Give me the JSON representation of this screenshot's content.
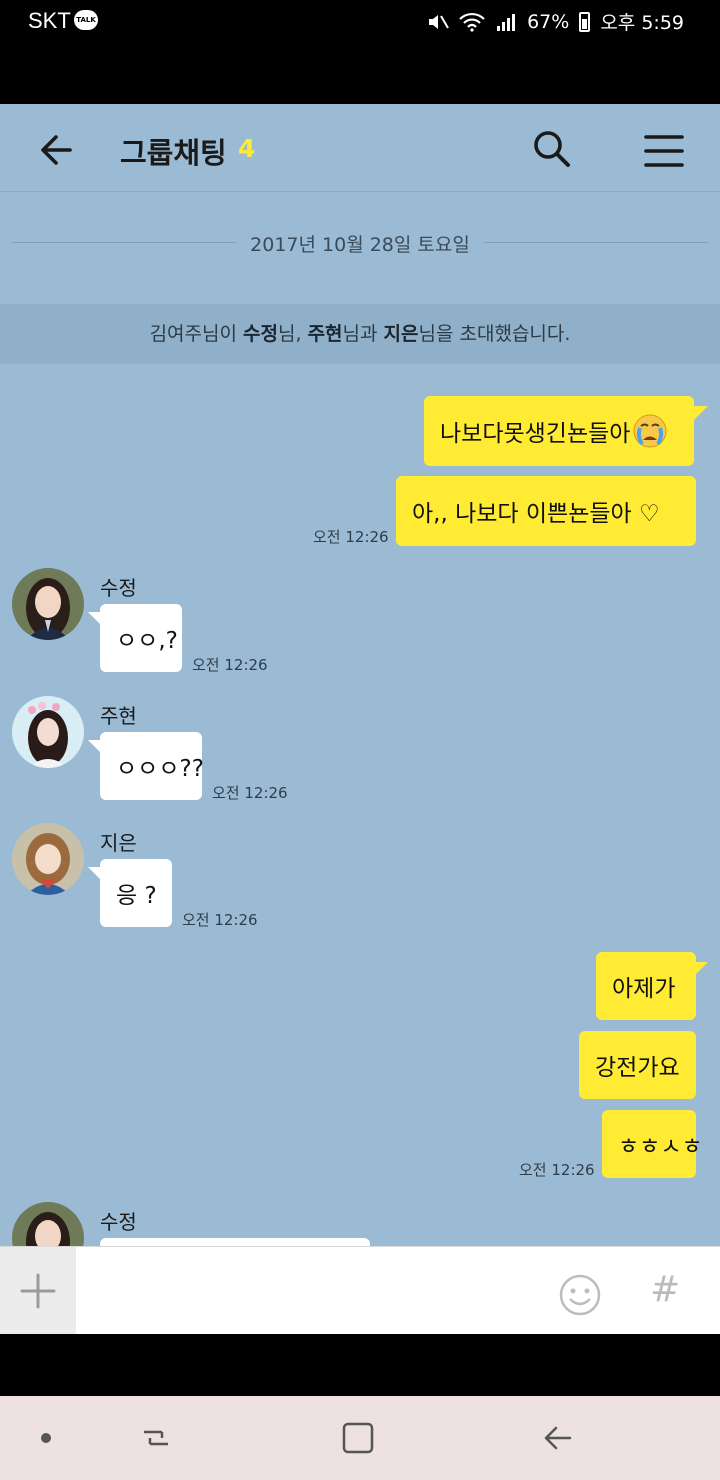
{
  "status_bar": {
    "carrier": "SKT",
    "talk_badge": "TALK",
    "battery": "67%",
    "time": "오후 5:59",
    "icons": [
      "talk-icon",
      "mute-icon",
      "wifi-icon",
      "signal-icon",
      "battery-icon"
    ]
  },
  "header": {
    "title": "그룹채팅",
    "member_count": "4",
    "icons": [
      "back-arrow-icon",
      "search-icon",
      "menu-icon"
    ]
  },
  "chat": {
    "date": "2017년 10월 28일 토요일",
    "system": {
      "inviter": "김여주님이 ",
      "name1": "수정",
      "sep1": "님, ",
      "name2": "주현",
      "sep2": "님과 ",
      "name3": "지은",
      "tail": "님을 초대했습니다."
    },
    "messages": [
      {
        "from": "me",
        "text": "나보다못생긴뇬들아",
        "emoji": "crying-face-icon"
      },
      {
        "from": "me",
        "text": "아,,  나보다 이쁜뇬들아 ♡",
        "time": "오전 12:26"
      },
      {
        "sender": "수정",
        "text": "ㅇㅇ,?",
        "time": "오전 12:26"
      },
      {
        "sender": "주현",
        "text": "ㅇㅇㅇ??",
        "time": "오전 12:26"
      },
      {
        "sender": "지은",
        "text": "응 ?",
        "time": "오전 12:26"
      },
      {
        "from": "me",
        "text": "아제가"
      },
      {
        "from": "me",
        "text": "강전가요"
      },
      {
        "from": "me",
        "text": "ㅎㅎㅅㅎ",
        "time": "오전 12:26"
      },
      {
        "sender": "수정",
        "text": ""
      }
    ]
  },
  "input_bar": {
    "add_label": "+",
    "hash_label": "#",
    "icons": [
      "plus-icon",
      "emoji-icon",
      "hash-icon"
    ]
  },
  "nav_bar": {
    "icons": [
      "dot-icon",
      "recent-apps-icon",
      "home-icon",
      "back-icon"
    ]
  },
  "colors": {
    "chat_background": "#9bbbd4",
    "my_bubble": "#ffeb33",
    "other_bubble": "#ffffff",
    "member_count": "#ffeb33"
  }
}
